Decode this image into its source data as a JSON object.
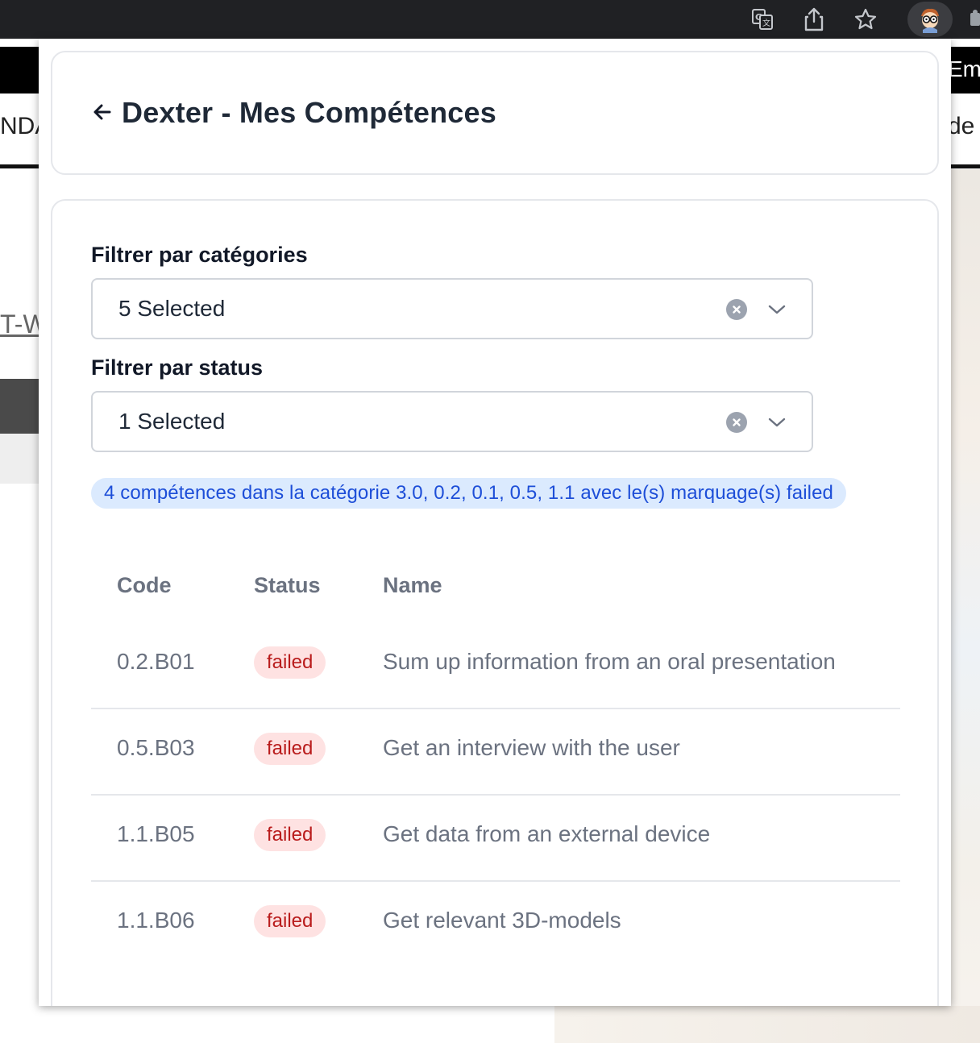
{
  "browser": {
    "toolbar_icons": [
      "translate-icon",
      "share-icon",
      "bookmark-star-icon",
      "extension-avatar-icon",
      "puzzle-icon"
    ]
  },
  "background_page": {
    "header_fragment": "Em",
    "nav_left_fragment": "NDA",
    "nav_right_fragment": "de",
    "link_fragment": "T-W"
  },
  "header": {
    "back_icon": "arrow-left-icon",
    "title": "Dexter - Mes Compétences"
  },
  "filters": {
    "categories": {
      "label": "Filtrer par catégories",
      "value": "5 Selected",
      "clear_icon": "clear-circle-icon",
      "dropdown_icon": "chevron-down-icon"
    },
    "status": {
      "label": "Filtrer par status",
      "value": "1 Selected",
      "clear_icon": "clear-circle-icon",
      "dropdown_icon": "chevron-down-icon"
    }
  },
  "summary": "4 compétences dans la catégorie 3.0, 0.2, 0.1, 0.5, 1.1 avec le(s) marquage(s) failed",
  "table": {
    "columns": [
      "Code",
      "Status",
      "Name"
    ],
    "rows": [
      {
        "code": "0.2.B01",
        "status": "failed",
        "name": "Sum up information from an oral presentation"
      },
      {
        "code": "0.5.B03",
        "status": "failed",
        "name": "Get an interview with the user"
      },
      {
        "code": "1.1.B05",
        "status": "failed",
        "name": "Get data from an external device"
      },
      {
        "code": "1.1.B06",
        "status": "failed",
        "name": "Get relevant 3D-models"
      }
    ]
  },
  "colors": {
    "badge_failed_bg": "#fee2e2",
    "badge_failed_text": "#b91c1c",
    "info_bg": "#dbeafe",
    "info_text": "#1d4ed8"
  }
}
